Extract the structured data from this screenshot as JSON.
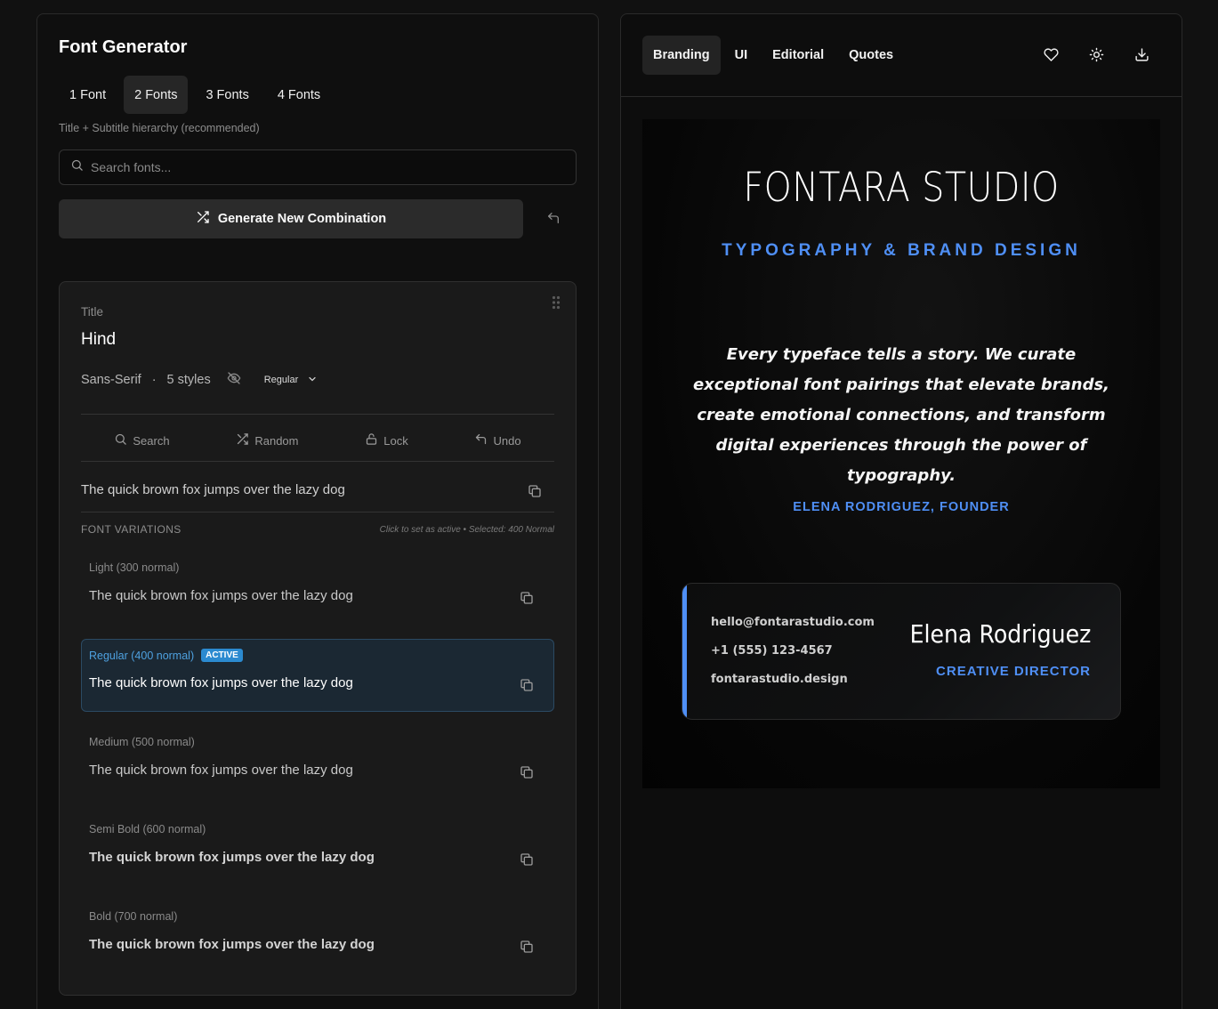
{
  "generator": {
    "title": "Font Generator",
    "count_tabs": [
      {
        "label": "1 Font",
        "active": false
      },
      {
        "label": "2 Fonts",
        "active": true
      },
      {
        "label": "3 Fonts",
        "active": false
      },
      {
        "label": "4 Fonts",
        "active": false
      }
    ],
    "hint": "Title + Subtitle hierarchy (recommended)",
    "search_placeholder": "Search fonts...",
    "generate_label": "Generate New Combination"
  },
  "font_card": {
    "role": "Title",
    "font_name": "Hind",
    "category": "Sans-Serif",
    "dot": "·",
    "styles": "5 styles",
    "weight_selected": "Regular",
    "actions": {
      "search": "Search",
      "random": "Random",
      "lock": "Lock",
      "undo": "Undo"
    },
    "sample": "The quick brown fox jumps over the lazy dog",
    "variations_header": "FONT VARIATIONS",
    "variations_note": "Click to set as active • Selected: 400 Normal",
    "active_badge": "ACTIVE",
    "variations": [
      {
        "label": "Light (300 normal)",
        "text": "The quick brown fox jumps over the lazy dog"
      },
      {
        "label": "Regular (400 normal)",
        "text": "The quick brown fox jumps over the lazy dog"
      },
      {
        "label": "Medium (500 normal)",
        "text": "The quick brown fox jumps over the lazy dog"
      },
      {
        "label": "Semi Bold (600 normal)",
        "text": "The quick brown fox jumps over the lazy dog"
      },
      {
        "label": "Bold (700 normal)",
        "text": "The quick brown fox jumps over the lazy dog"
      }
    ]
  },
  "preview": {
    "tabs": [
      {
        "label": "Branding",
        "active": true
      },
      {
        "label": "UI",
        "active": false
      },
      {
        "label": "Editorial",
        "active": false
      },
      {
        "label": "Quotes",
        "active": false
      }
    ],
    "icons": [
      "heart-icon",
      "sun-icon",
      "download-icon"
    ],
    "brand_title": "FONTARA STUDIO",
    "brand_subtitle": "TYPOGRAPHY & BRAND DESIGN",
    "quote": "Every typeface tells a story. We curate exceptional font pairings that elevate brands, create emotional connections, and transform digital experiences through the power of typography.",
    "author": "ELENA RODRIGUEZ, FOUNDER",
    "card": {
      "email": "hello@fontarastudio.com",
      "phone": "+1 (555) 123-4567",
      "website": "fontarastudio.design",
      "name": "Elena Rodriguez",
      "role": "CREATIVE DIRECTOR"
    }
  },
  "colors": {
    "accent": "#4f8ff5",
    "active_badge": "#2b8ad0",
    "background": "#111111"
  }
}
